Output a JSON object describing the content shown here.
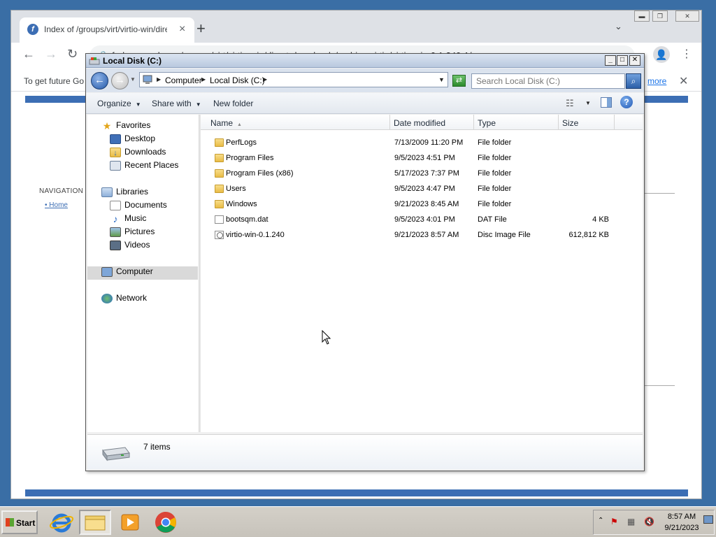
{
  "browser": {
    "tab_title": "Index of /groups/virt/virtio-win/dire",
    "url": "fedorapeople.org/groups/virt/virtio-win/direct-downloads/archive-virtio/virtio-win-0.1.240-1/",
    "infobar_text": "To get future Go",
    "infobar_link": "more",
    "page_nav_heading": "NAVIGATION",
    "page_nav_home": "Home",
    "brand_color": "#3c6eb4"
  },
  "explorer": {
    "title": "Local Disk (C:)",
    "breadcrumb": [
      "Computer",
      "Local Disk (C:)"
    ],
    "search_placeholder": "Search Local Disk (C:)",
    "commands": {
      "organize": "Organize",
      "share_with": "Share with",
      "new_folder": "New folder"
    },
    "nav": {
      "favorites": "Favorites",
      "desktop": "Desktop",
      "downloads": "Downloads",
      "recent_places": "Recent Places",
      "libraries": "Libraries",
      "documents": "Documents",
      "music": "Music",
      "pictures": "Pictures",
      "videos": "Videos",
      "computer": "Computer",
      "network": "Network"
    },
    "columns": {
      "name": "Name",
      "date_modified": "Date modified",
      "type": "Type",
      "size": "Size"
    },
    "files": [
      {
        "name": "PerfLogs",
        "date": "7/13/2009 11:20 PM",
        "type": "File folder",
        "size": "",
        "icon": "folder-icon"
      },
      {
        "name": "Program Files",
        "date": "9/5/2023 4:51 PM",
        "type": "File folder",
        "size": "",
        "icon": "folder-icon"
      },
      {
        "name": "Program Files (x86)",
        "date": "5/17/2023 7:37 PM",
        "type": "File folder",
        "size": "",
        "icon": "folder-icon"
      },
      {
        "name": "Users",
        "date": "9/5/2023 4:47 PM",
        "type": "File folder",
        "size": "",
        "icon": "folder-icon"
      },
      {
        "name": "Windows",
        "date": "9/21/2023 8:45 AM",
        "type": "File folder",
        "size": "",
        "icon": "folder-icon"
      },
      {
        "name": "bootsqm.dat",
        "date": "9/5/2023 4:01 PM",
        "type": "DAT File",
        "size": "4 KB",
        "icon": "document-icon"
      },
      {
        "name": "virtio-win-0.1.240",
        "date": "9/21/2023 8:57 AM",
        "type": "Disc Image File",
        "size": "612,812 KB",
        "icon": "disc-image-icon"
      }
    ],
    "status": "7 items"
  },
  "taskbar": {
    "start_label": "Start",
    "clock_time": "8:57 AM",
    "clock_date": "9/21/2023"
  }
}
